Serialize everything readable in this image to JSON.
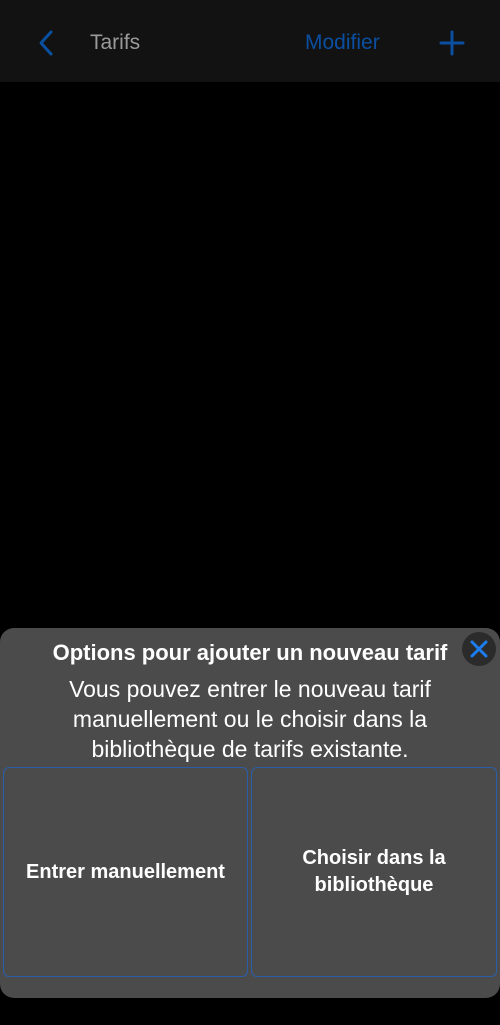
{
  "navbar": {
    "back_icon": "chevron-left-icon",
    "title": "Tarifs",
    "edit_label": "Modifier",
    "add_icon": "plus-icon"
  },
  "sheet": {
    "title": "Options pour ajouter un nouveau tarif",
    "description": "Vous pouvez entrer le nouveau tarif manuellement ou le choisir dans la bibliothèque de tarifs existante.",
    "close_icon": "close-icon",
    "options": [
      {
        "label": "Entrer manuellement"
      },
      {
        "label": "Choisir dans la bibliothèque"
      }
    ]
  },
  "colors": {
    "accent": "#0a4fa0",
    "close_accent": "#1a7df0",
    "sheet_background": "#4b4b4b",
    "navbar_background": "#121212",
    "option_border": "#2a5fa8"
  }
}
